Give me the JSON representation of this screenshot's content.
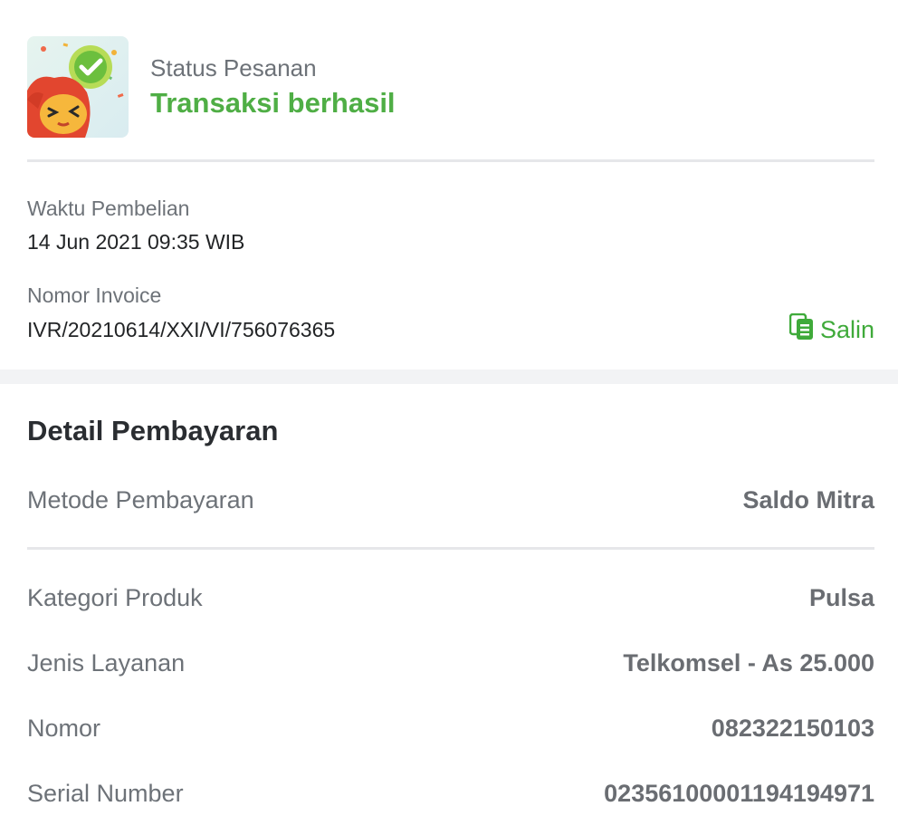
{
  "status": {
    "label": "Status Pesanan",
    "value": "Transaksi berhasil",
    "illustration_icon": "success-mascot-icon"
  },
  "purchase": {
    "time_label": "Waktu Pembelian",
    "time_value": "14 Jun 2021 09:35 WIB",
    "invoice_label": "Nomor Invoice",
    "invoice_value": "IVR/20210614/XXI/VI/756076365",
    "copy_label": "Salin",
    "copy_icon": "copy-icon"
  },
  "payment": {
    "title": "Detail Pembayaran",
    "method_label": "Metode Pembayaran",
    "method_value": "Saldo Mitra",
    "rows": [
      {
        "label": "Kategori Produk",
        "value": "Pulsa"
      },
      {
        "label": "Jenis Layanan",
        "value": "Telkomsel - As 25.000"
      },
      {
        "label": "Nomor",
        "value": "082322150103"
      },
      {
        "label": "Serial Number",
        "value": "02356100001194194971"
      }
    ]
  },
  "colors": {
    "success_green": "#4fae45",
    "accent_green": "#3faa3a",
    "muted_text": "#6d7278",
    "divider": "#e6e7ea"
  }
}
